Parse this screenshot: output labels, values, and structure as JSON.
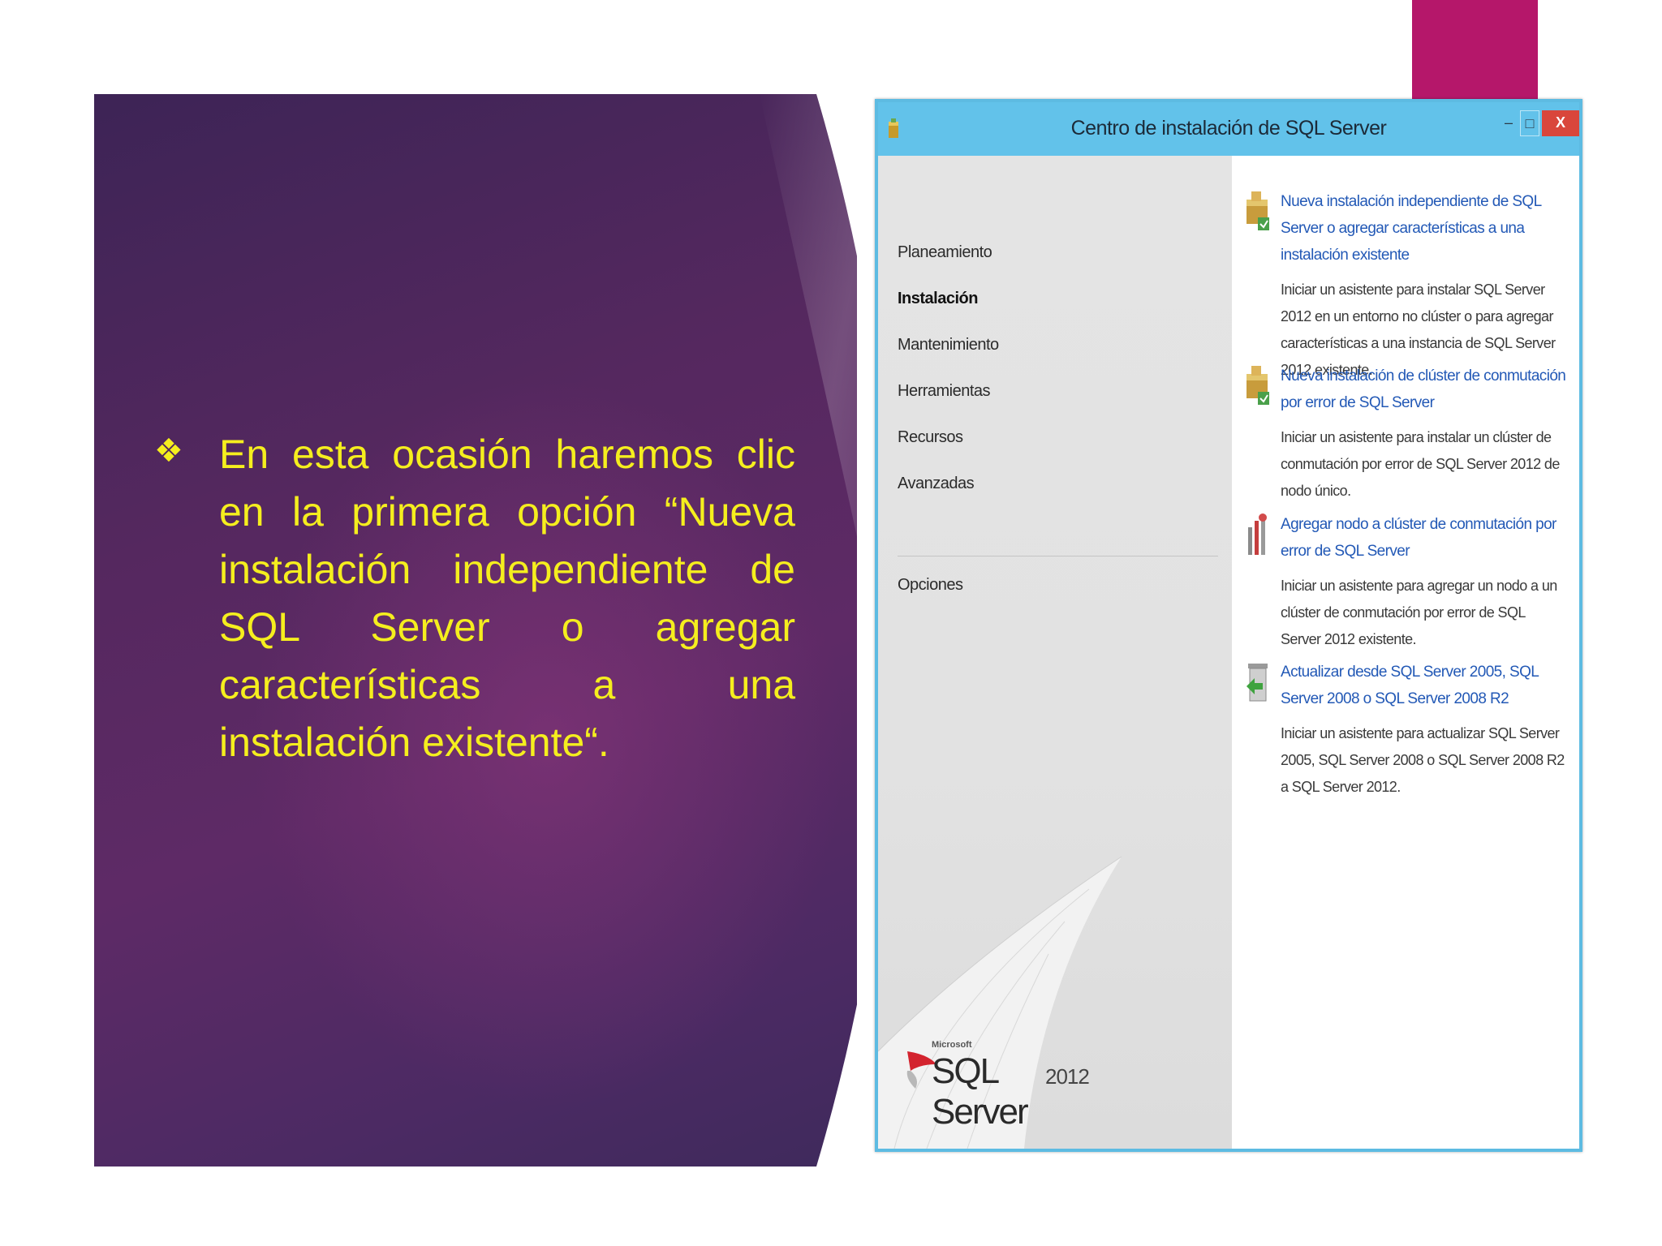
{
  "slide": {
    "bullet_symbol": "❖",
    "bullet_text": "En esta ocasión haremos clic en la primera opción “Nueva instalación independiente de SQL Server o agregar características a una instalación existente“.",
    "colors": {
      "accent": "#b5176a",
      "panel": "#5e2a66",
      "text": "#f5ee1e"
    }
  },
  "window": {
    "title": "Centro de instalación de SQL Server",
    "controls": {
      "minimize": "–",
      "maximize": "□",
      "close": "X"
    },
    "sidebar": {
      "items": [
        {
          "label": "Planeamiento",
          "active": false
        },
        {
          "label": "Instalación",
          "active": true
        },
        {
          "label": "Mantenimiento",
          "active": false
        },
        {
          "label": "Herramientas",
          "active": false
        },
        {
          "label": "Recursos",
          "active": false
        },
        {
          "label": "Avanzadas",
          "active": false
        }
      ],
      "options_item": {
        "label": "Opciones"
      },
      "logo": {
        "brand": "Microsoft",
        "product": "SQL Server",
        "version": "2012"
      }
    },
    "content": {
      "options": [
        {
          "icon": "box-install-icon",
          "title": "Nueva instalación independiente de SQL Server o agregar características a una instalación existente",
          "description": "Iniciar un asistente para instalar SQL Server 2012 en un entorno no clúster o para agregar características a una instancia de SQL Server 2012 existente."
        },
        {
          "icon": "box-cluster-icon",
          "title": "Nueva instalación de clúster de conmutación por error de SQL Server",
          "description": "Iniciar un asistente para instalar un clúster de conmutación por error de SQL Server 2012 de nodo único."
        },
        {
          "icon": "tools-node-icon",
          "title": "Agregar nodo a clúster de conmutación por error de SQL Server",
          "description": "Iniciar un asistente para agregar un nodo a un clúster de conmutación por error de SQL Server 2012 existente."
        },
        {
          "icon": "upgrade-icon",
          "title": "Actualizar desde SQL Server 2005, SQL Server 2008 o SQL Server 2008 R2",
          "description": "Iniciar un asistente para actualizar SQL Server 2005, SQL Server 2008 o SQL Server 2008 R2 a SQL Server 2012."
        }
      ]
    }
  }
}
